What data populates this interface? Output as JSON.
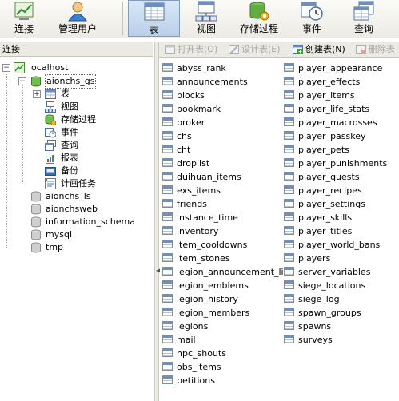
{
  "toolbar": {
    "buttons": [
      {
        "label": "连接",
        "icon": "connect-icon"
      },
      {
        "label": "管理用户",
        "icon": "user-icon"
      },
      {
        "label": "表",
        "icon": "table-icon",
        "active": true
      },
      {
        "label": "视图",
        "icon": "view-icon"
      },
      {
        "label": "存储过程",
        "icon": "procedure-icon"
      },
      {
        "label": "事件",
        "icon": "event-icon"
      },
      {
        "label": "查询",
        "icon": "query-icon"
      }
    ]
  },
  "connections": {
    "header": "连接",
    "server": "localhost",
    "selected_db": "aionchs_gs",
    "db_children": [
      "表",
      "视图",
      "存储过程",
      "事件",
      "查询",
      "报表",
      "备份",
      "计画任务"
    ],
    "other_dbs": [
      "aionchs_ls",
      "aionchsweb",
      "information_schema",
      "mysql",
      "tmp"
    ]
  },
  "object_toolbar": {
    "open_table": "打开表(O)",
    "design_table": "设计表(E)",
    "create_table": "创建表(N)",
    "delete_table": "删除表"
  },
  "tables": {
    "column1": [
      "abyss_rank",
      "announcements",
      "blocks",
      "bookmark",
      "broker",
      "chs",
      "cht",
      "droplist",
      "duihuan_items",
      "exs_items",
      "friends",
      "instance_time",
      "inventory",
      "item_cooldowns",
      "item_stones",
      "legion_announcement_list",
      "legion_emblems",
      "legion_history",
      "legion_members",
      "legions",
      "mail",
      "npc_shouts",
      "obs_items",
      "petitions"
    ],
    "column2": [
      "player_appearance",
      "player_effects",
      "player_items",
      "player_life_stats",
      "player_macrosses",
      "player_passkey",
      "player_pets",
      "player_punishments",
      "player_quests",
      "player_recipes",
      "player_settings",
      "player_skills",
      "player_titles",
      "player_world_bans",
      "players",
      "server_variables",
      "siege_locations",
      "siege_log",
      "spawn_groups",
      "spawns",
      "surveys"
    ]
  }
}
